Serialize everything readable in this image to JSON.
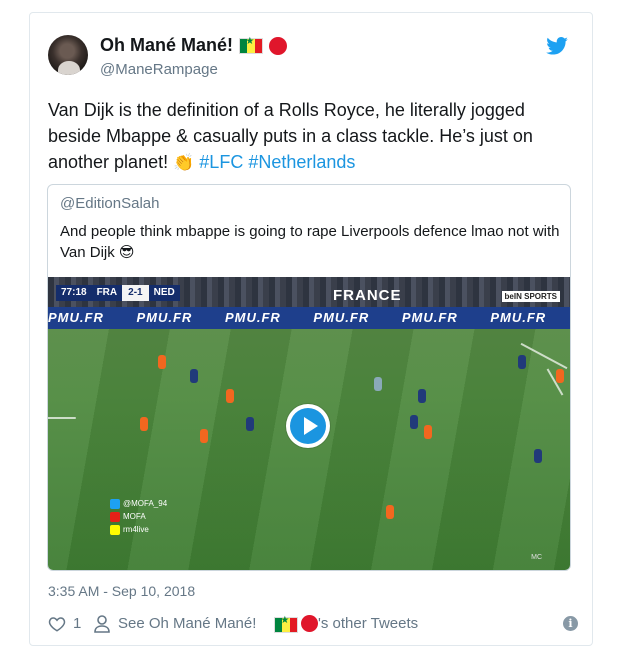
{
  "tweet": {
    "display_name": "Oh Mané Mané!",
    "handle": "@ManeRampage",
    "text_main": "Van Dijk is the definition of a Rolls Royce, he literally jogged beside Mbappe & casually puts in a class tackle. He’s just on another planet!",
    "clap_emoji": "👏",
    "hashtag_1": "#LFC",
    "hashtag_2": "#Netherlands",
    "timestamp": "3:35 AM - Sep 10, 2018",
    "like_count": "1",
    "see_other_prefix": "See Oh Mané Mané!",
    "see_other_suffix": "'s other Tweets"
  },
  "quoted_tweet": {
    "handle": "@EditionSalah",
    "text": "And people think mbappe is going to rape Liverpools defence lmao not with Van Dijk",
    "emoji": "😎"
  },
  "video": {
    "scorebug": {
      "time": "77:18",
      "home": "FRA",
      "score": "2-1",
      "away": "NED"
    },
    "stadium_sign": "FRANCE",
    "channel": "beIN SPORTS",
    "ad_text": "PMU.FR",
    "social_lines": [
      "@MOFA_94",
      "MOFA",
      "rm4live"
    ],
    "watermark": "MC"
  },
  "colors": {
    "link": "#1b95e0",
    "secondary_text": "#657786",
    "border": "#e1e8ed"
  },
  "icons": {
    "twitter": "twitter-bird-icon",
    "like": "heart-icon",
    "profile": "person-icon",
    "info": "info-icon",
    "play": "play-icon"
  }
}
